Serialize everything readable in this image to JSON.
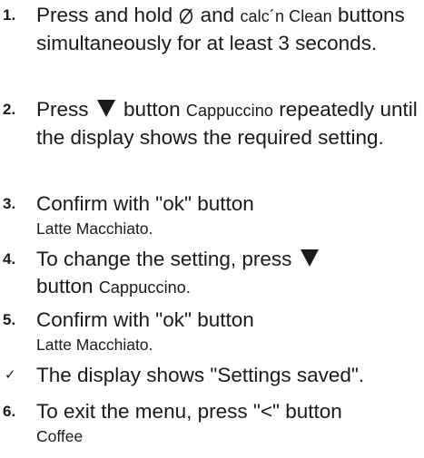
{
  "steps": [
    {
      "number": "1.",
      "text_before": "Press and hold",
      "icon": "rinse-cleaning-icon",
      "text_mid": "and",
      "button_label": "calc´n Clean",
      "text_after": "buttons simultaneously for at least 3 seconds."
    },
    {
      "number": "2.",
      "text_before": "Press",
      "icon": "down-triangle-icon",
      "text_mid": "button",
      "button_label": "Cappuccino",
      "text_after": "repeatedly until the display shows the required setting."
    },
    {
      "number": "3.",
      "text": "Confirm with \"ok\" button",
      "button_label": "Latte Macchiato",
      "trailing": "."
    },
    {
      "number": "4.",
      "text_before": "To change the setting, press",
      "icon": "down-triangle-icon",
      "text_mid": "button",
      "button_label": "Cappuccino",
      "trailing": "."
    },
    {
      "number": "5.",
      "text": "Confirm with \"ok\" button",
      "button_label": "Latte Macchiato",
      "trailing": "."
    },
    {
      "marker": "✓",
      "text": "The display shows \"Settings saved\"."
    },
    {
      "number": "6.",
      "text": "To exit the menu, press \"<\" button",
      "button_label": "Coffee"
    }
  ]
}
